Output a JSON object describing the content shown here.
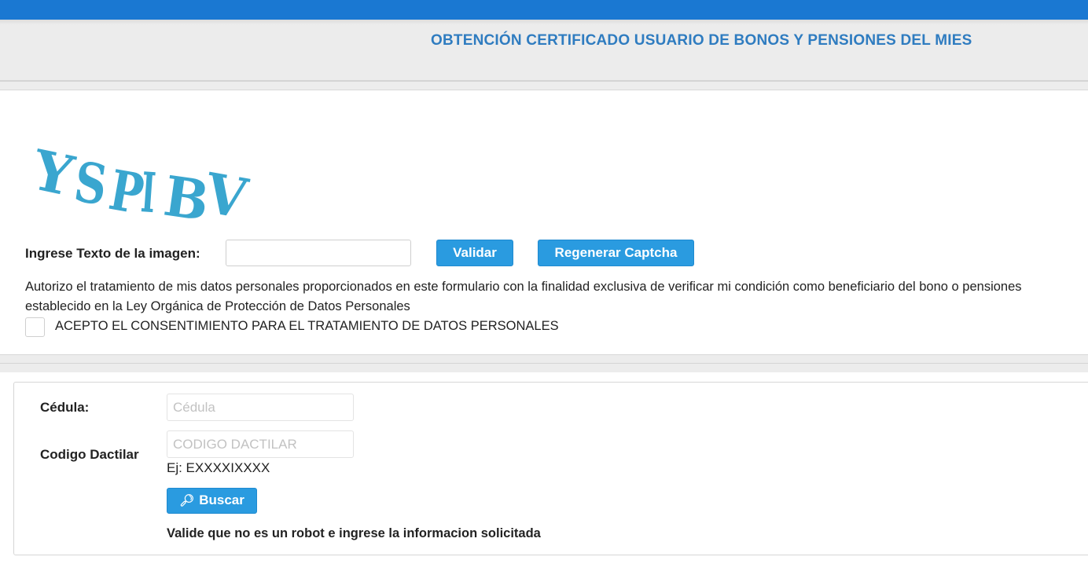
{
  "header": {
    "title": "OBTENCIÓN CERTIFICADO USUARIO DE BONOS Y PENSIONES DEL MIES"
  },
  "captcha": {
    "image_text": "YSPIBV",
    "label": "Ingrese Texto de la imagen:",
    "input_value": "",
    "validate_label": "Validar",
    "regenerate_label": "Regenerar Captcha"
  },
  "consent": {
    "text_line1": "Autorizo el tratamiento de mis datos personales proporcionados en este formulario con la finalidad exclusiva de verificar mi condición como beneficiario del bono o pensiones",
    "text_line2": "establecido en la Ley Orgánica de Protección de Datos Personales",
    "checkbox_label": "ACEPTO EL CONSENTIMIENTO PARA EL TRATAMIENTO DE DATOS PERSONALES",
    "checked": false
  },
  "form": {
    "cedula_label": "Cédula:",
    "cedula_placeholder": "Cédula",
    "codigo_label": "Codigo Dactilar",
    "codigo_placeholder": "CODIGO DACTILAR",
    "codigo_hint": "Ej: EXXXXIXXXX",
    "search_label": "Buscar",
    "search_icon": "search-icon",
    "robot_note": "Valide que no es un robot e ingrese la informacion solicitada"
  },
  "colors": {
    "topbar": "#1a78d2",
    "title": "#2f7cc0",
    "button": "#2a9be0",
    "captcha": "#3aa6cf"
  }
}
